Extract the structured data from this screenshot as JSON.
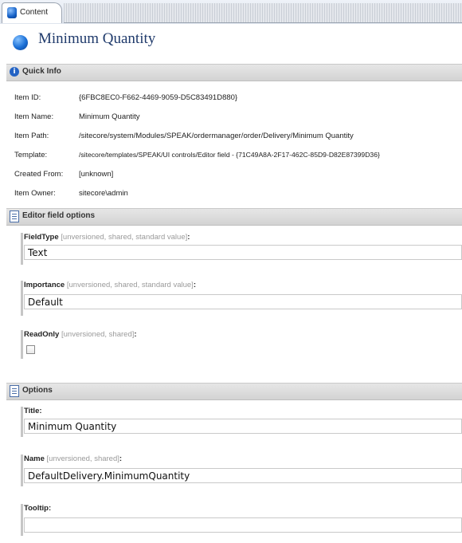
{
  "tab": {
    "label": "Content"
  },
  "page_title": "Minimum Quantity",
  "quick_info": {
    "title": "Quick Info",
    "rows": [
      {
        "key": "Item ID:",
        "value": "{6FBC8EC0-F662-4469-9059-D5C83491D880}"
      },
      {
        "key": "Item Name:",
        "value": "Minimum Quantity"
      },
      {
        "key": "Item Path:",
        "value": "/sitecore/system/Modules/SPEAK/ordermanager/order/Delivery/Minimum Quantity"
      },
      {
        "key": "Template:",
        "value": "/sitecore/templates/SPEAK/UI controls/Editor field - {71C49A8A-2F17-462C-85D9-D82E87399D36}"
      },
      {
        "key": "Created From:",
        "value": "[unknown]"
      },
      {
        "key": "Item Owner:",
        "value": "sitecore\\admin"
      }
    ]
  },
  "editor_field_options": {
    "title": "Editor field options",
    "fields": {
      "fieldtype": {
        "label": "FieldType",
        "meta": "[unversioned, shared, standard value]",
        "colon": ":",
        "value": "Text"
      },
      "importance": {
        "label": "Importance",
        "meta": "[unversioned, shared, standard value]",
        "colon": ":",
        "value": "Default"
      },
      "readonly": {
        "label": "ReadOnly",
        "meta": "[unversioned, shared]",
        "colon": ":",
        "checked": false
      }
    }
  },
  "options": {
    "title": "Options",
    "fields": {
      "title": {
        "label": "Title:",
        "value": "Minimum Quantity"
      },
      "name": {
        "label": "Name",
        "meta": "[unversioned, shared]",
        "colon": ":",
        "value": "DefaultDelivery.MinimumQuantity"
      },
      "tooltip": {
        "label": "Tooltip:",
        "value": ""
      }
    }
  },
  "colors": {
    "title_text": "#1f3a6b",
    "icon_blue": "#1a6fd6",
    "section_bg": "#dcdcdc",
    "meta_text": "#9a9a9a"
  },
  "icons": {
    "tab": "content-icon",
    "header": "item-icon",
    "quick_info": "info-icon",
    "section": "document-icon"
  }
}
